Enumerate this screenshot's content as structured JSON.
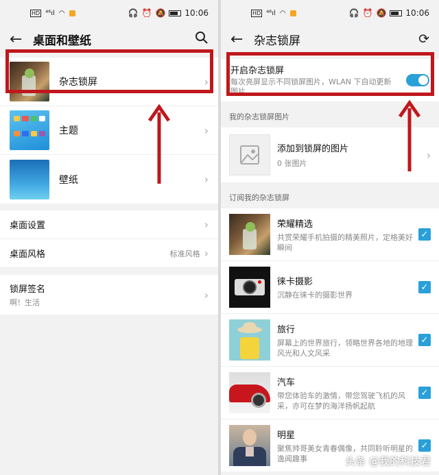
{
  "left": {
    "status": {
      "time": "10:06",
      "signal": "⁴⁶ıl"
    },
    "title": "桌面和壁纸",
    "items": [
      {
        "label": "杂志锁屏"
      },
      {
        "label": "主题"
      },
      {
        "label": "壁纸"
      }
    ],
    "settings": [
      {
        "label": "桌面设置",
        "value": ""
      },
      {
        "label": "桌面风格",
        "value": "标准风格"
      }
    ],
    "lock_signature": {
      "title": "锁屏签名",
      "subtitle": "啊！生活"
    }
  },
  "right": {
    "status": {
      "time": "10:06",
      "signal": "⁴⁶ıl"
    },
    "title": "杂志锁屏",
    "toggle": {
      "title": "开启杂志锁屏",
      "subtitle": "每次亮屏显示不同锁屏图片，WLAN 下自动更新图片",
      "on": true
    },
    "my_pictures_header": "我的杂志锁屏图片",
    "add": {
      "title": "添加到锁屏的图片",
      "subtitle": "0 张图片"
    },
    "subscribe_header": "订阅我的杂志锁屏",
    "subscriptions": [
      {
        "title": "荣耀精选",
        "desc": "共赏荣耀手机拍摄的精美照片，定格美好瞬间",
        "checked": true
      },
      {
        "title": "徕卡摄影",
        "desc": "沉静在徕卡的摄影世界",
        "checked": true
      },
      {
        "title": "旅行",
        "desc": "屏幕上的世界旅行，领略世界各地的地理风光和人文风采",
        "checked": true
      },
      {
        "title": "汽车",
        "desc": "带您体验车的激情，带您驾驶飞机的风采，亦可在梦的海洋扬帆起航",
        "checked": true
      },
      {
        "title": "明星",
        "desc": "聚焦帅哥美女青春偶像，共同聆听明星的逸闻趣事",
        "checked": true
      }
    ],
    "watermark": "头条 @我的科技君"
  },
  "colors": {
    "accent": "#2aa0d8",
    "annotation_red": "#c0171c"
  }
}
